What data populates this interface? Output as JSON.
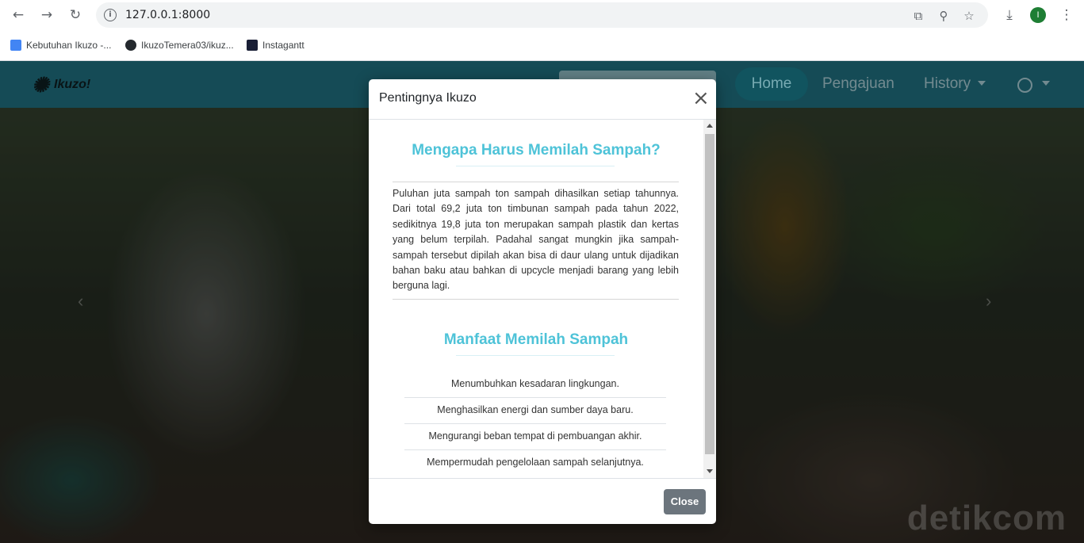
{
  "browser": {
    "url": "127.0.0.1:8000",
    "profile_initial": "I",
    "bookmarks": [
      {
        "label": "Kebutuhan Ikuzo -..."
      },
      {
        "label": "IkuzoTemera03/ikuz..."
      },
      {
        "label": "Instagantt"
      }
    ]
  },
  "navbar": {
    "logo_text": "Ikuzo!",
    "links": {
      "home": "Home",
      "pengajuan": "Pengajuan",
      "history": "History"
    }
  },
  "hero": {
    "watermark": "detikcom"
  },
  "modal": {
    "title": "Pentingnya Ikuzo",
    "section1": {
      "heading": "Mengapa Harus Memilah Sampah?",
      "paragraph": "Puluhan juta sampah ton sampah dihasilkan setiap tahunnya. Dari total 69,2 juta ton timbunan sampah pada tahun 2022, sedikitnya 19,8 juta ton merupakan sampah plastik dan kertas yang belum terpilah. Padahal sangat mungkin jika sampah-sampah tersebut dipilah akan bisa di daur ulang untuk dijadikan bahan baku atau bahkan di upcycle menjadi barang yang lebih berguna lagi."
    },
    "section2": {
      "heading": "Manfaat Memilah Sampah",
      "items": [
        "Menumbuhkan kesadaran lingkungan.",
        "Menghasilkan energi dan sumber daya baru.",
        "Mengurangi beban tempat di pembuangan akhir.",
        "Mempermudah pengelolaan sampah selanjutnya."
      ]
    },
    "close_label": "Close"
  }
}
